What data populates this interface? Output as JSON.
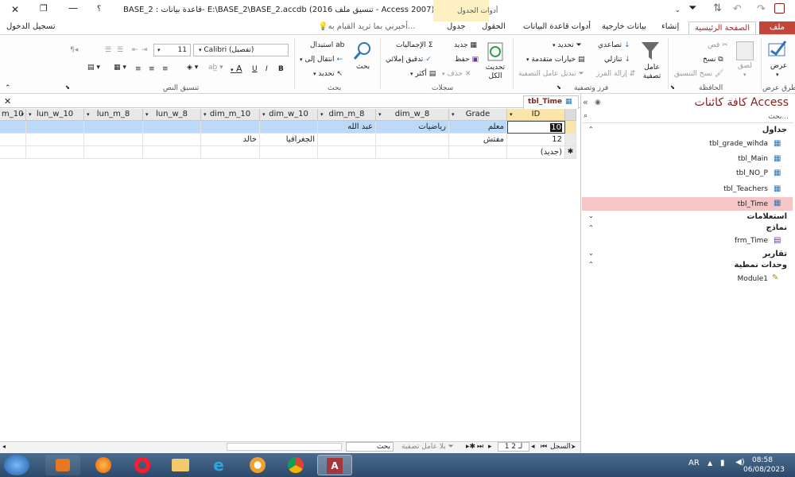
{
  "window": {
    "title": "BASE_2 : قاعدة بيانات- E:\\BASE_2\\BASE_2.accdb (تنسيق ملف 2016 - Access 2007) - Acc...",
    "help": "؟",
    "signin": "تسجيل الدخول"
  },
  "context_tab": {
    "label": "أدوات الجدول"
  },
  "tabs": {
    "file": "ملف",
    "home": "الصفحة الرئيسية",
    "create": "إنشاء",
    "external": "بيانات خارجية",
    "dbtools": "أدوات قاعدة البيانات",
    "fields": "الحقول",
    "table": "جدول",
    "tellme": "أخبرني بما تريد القيام به..."
  },
  "ribbon": {
    "views": {
      "view": "عرض",
      "group": "طرق عرض"
    },
    "clipboard": {
      "paste": "لصق",
      "cut": "قص",
      "copy": "نسخ",
      "format_painter": "نسخ التنسيق",
      "group": "الحافظة"
    },
    "sort_filter": {
      "filter": "عامل تصفية",
      "ascending": "تصاعدي",
      "descending": "تنازلي",
      "remove_sort": "إزالة الفرز",
      "selection": "تحديد",
      "advanced": "خيارات متقدمة",
      "toggle_filter": "تبديل عامل التصفية",
      "group": "فرز وتصفية"
    },
    "records": {
      "refresh": "تحديث الكل",
      "new": "جديد",
      "save": "حفظ",
      "delete": "حذف",
      "totals": "الإجماليات",
      "spelling": "تدقيق إملائي",
      "more": "أكثر",
      "group": "سجلات"
    },
    "find": {
      "find": "بحث",
      "replace": "استبدال",
      "goto": "انتقال إلى",
      "select": "تحديد",
      "group": "بحث"
    },
    "text_format": {
      "font": "Calibri (تفصيل)",
      "size": "11",
      "group": "تنسيق النص",
      "bold": "B",
      "italic": "I",
      "underline": "U",
      "font_color": "A"
    }
  },
  "nav_pane": {
    "title": "كافة كائنات Access",
    "search_placeholder": "بحث...",
    "groups": [
      {
        "name": "جداول",
        "items": [
          "tbl_grade_wihda",
          "tbl_Main",
          "tbl_NO_P",
          "tbl_Teachers",
          "tbl_Time"
        ]
      },
      {
        "name": "استعلامات",
        "items": []
      },
      {
        "name": "نماذج",
        "items": [
          "frm_Time"
        ]
      },
      {
        "name": "تقارير",
        "items": []
      },
      {
        "name": "وحدات نمطية",
        "items": [
          "Module1"
        ]
      }
    ]
  },
  "document": {
    "tab_label": "tbl_Time",
    "columns": [
      "ID",
      "Grade",
      "dim_w_8",
      "dim_m_8",
      "dim_w_10",
      "dim_m_10",
      "lun_w_8",
      "lun_m_8",
      "lun_w_10",
      "m_10"
    ],
    "rows": [
      {
        "ID": "10",
        "Grade": "معلم",
        "dim_w_8": "رياضيات",
        "dim_m_8": "عبد الله",
        "dim_w_10": "",
        "dim_m_10": "",
        "lun_w_8": "",
        "lun_m_8": "",
        "lun_w_10": "",
        "m_10": ""
      },
      {
        "ID": "12",
        "Grade": "مفتش",
        "dim_w_8": "",
        "dim_m_8": "",
        "dim_w_10": "الجغرافيا",
        "dim_m_10": "خالد",
        "lun_w_8": "",
        "lun_m_8": "",
        "lun_w_10": "",
        "m_10": ""
      }
    ],
    "new_row": "(جديد)"
  },
  "status": {
    "record_label": "السجل:",
    "record_pos": "1 لـ 2",
    "filter": "بلا عامل تصفية",
    "search": "بحث"
  },
  "taskbar": {
    "lang": "AR",
    "time": "08:58",
    "date": "06/08/2023"
  }
}
